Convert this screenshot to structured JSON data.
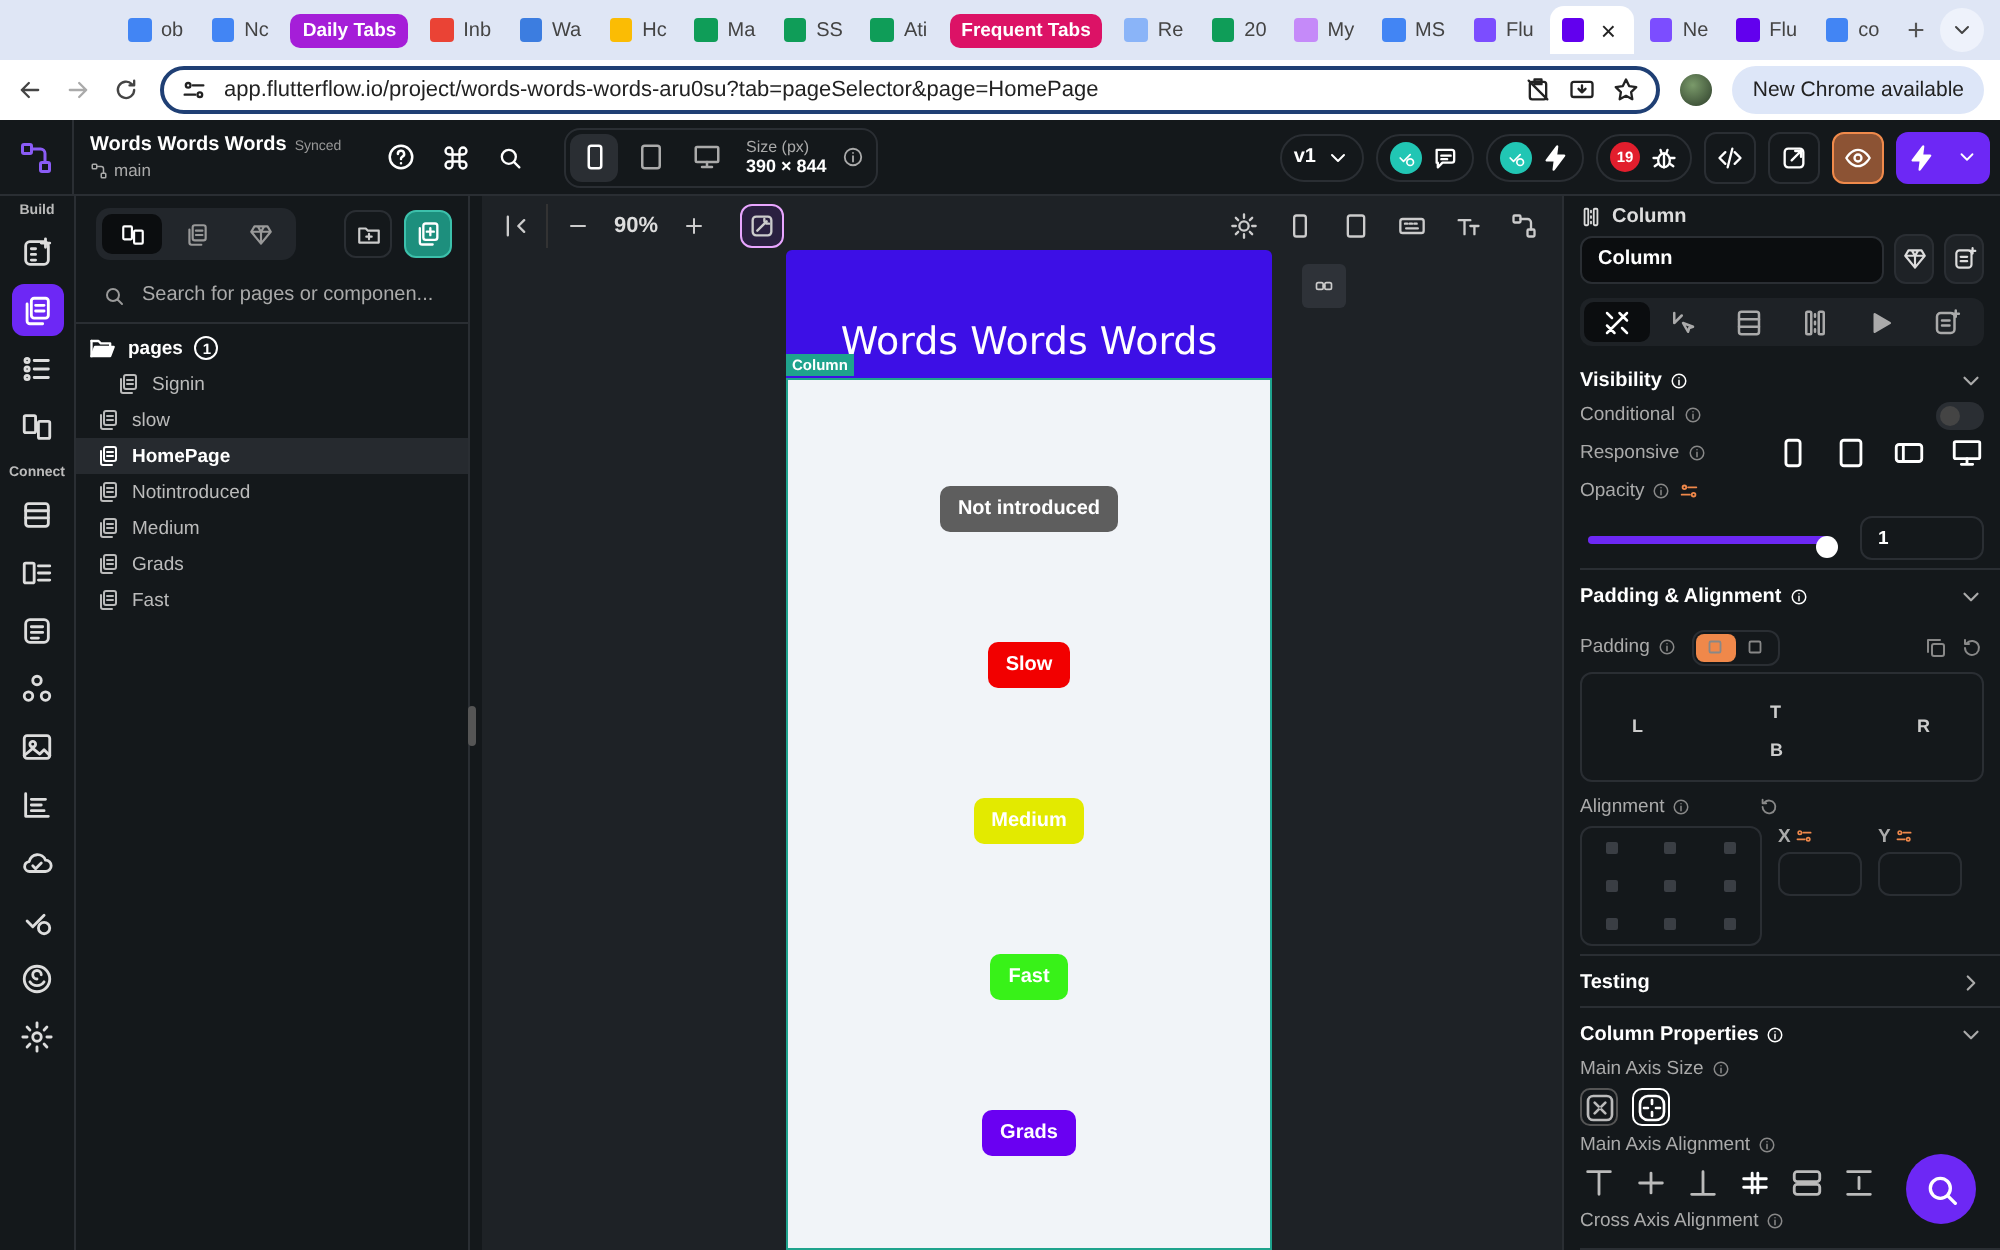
{
  "browser": {
    "tabs": [
      {
        "kind": "tab",
        "title": "ob",
        "selected": false
      },
      {
        "kind": "tab",
        "title": "Nc",
        "selected": false
      },
      {
        "kind": "group",
        "title": "Daily Tabs",
        "color": "#a51ed8"
      },
      {
        "kind": "tab",
        "title": "Inb",
        "selected": false
      },
      {
        "kind": "tab",
        "title": "Wa",
        "selected": false
      },
      {
        "kind": "tab",
        "title": "Hc",
        "selected": false
      },
      {
        "kind": "tab",
        "title": "Ma",
        "selected": false
      },
      {
        "kind": "tab",
        "title": "SS",
        "selected": false
      },
      {
        "kind": "tab",
        "title": "Ati",
        "selected": false
      },
      {
        "kind": "group",
        "title": "Frequent Tabs",
        "color": "#dc1266"
      },
      {
        "kind": "tab",
        "title": "Re",
        "selected": false
      },
      {
        "kind": "tab",
        "title": "20",
        "selected": false
      },
      {
        "kind": "tab",
        "title": "My",
        "selected": false
      },
      {
        "kind": "tab",
        "title": "MS",
        "selected": false
      },
      {
        "kind": "tab",
        "title": "Flu",
        "selected": false
      },
      {
        "kind": "tab",
        "selected": true,
        "close": "×"
      },
      {
        "kind": "tab",
        "title": "Ne",
        "selected": false
      },
      {
        "kind": "tab",
        "title": "Flu",
        "selected": false
      },
      {
        "kind": "tab",
        "title": "co",
        "selected": false
      }
    ],
    "new_tab": "+",
    "url": "app.flutterflow.io/project/words-words-words-aru0su?tab=pageSelector&page=HomePage",
    "update_button": "New Chrome available"
  },
  "toolbar": {
    "project": "Words Words Words",
    "sync_status": "Synced",
    "branch": "main",
    "devices": [
      {
        "kind": "phone",
        "selected": true
      },
      {
        "kind": "tablet",
        "selected": false
      },
      {
        "kind": "desktop",
        "selected": false
      }
    ],
    "size_label": "Size (px)",
    "size": "390 × 844",
    "version": "v1",
    "issues_count": "19",
    "preview_active": true
  },
  "rail": {
    "sections": [
      {
        "title": "Build",
        "items": [
          {
            "selected": false
          },
          {
            "selected": true
          },
          {
            "selected": false
          },
          {
            "selected": false
          }
        ]
      },
      {
        "title": "Connect",
        "items": [
          {
            "selected": false
          },
          {
            "selected": false
          },
          {
            "selected": false
          },
          {
            "selected": false
          },
          {
            "selected": false
          },
          {
            "selected": false
          },
          {
            "selected": false
          },
          {
            "selected": false
          },
          {
            "selected": false
          },
          {
            "selected": false
          }
        ]
      }
    ]
  },
  "pages_panel": {
    "tabs": [
      {
        "selected": true
      },
      {
        "selected": false
      },
      {
        "selected": false
      }
    ],
    "search_placeholder": "Search for pages or componen...",
    "tree": [
      {
        "kind": "folder",
        "name": "pages",
        "count": "1",
        "expanded": true,
        "children": [
          {
            "kind": "page",
            "name": "Signin",
            "selected": false
          }
        ]
      },
      {
        "kind": "page",
        "name": "slow",
        "selected": false
      },
      {
        "kind": "page",
        "name": "HomePage",
        "selected": true
      },
      {
        "kind": "page",
        "name": "Notintroduced",
        "selected": false
      },
      {
        "kind": "page",
        "name": "Medium",
        "selected": false
      },
      {
        "kind": "page",
        "name": "Grads",
        "selected": false
      },
      {
        "kind": "page",
        "name": "Fast",
        "selected": false
      }
    ]
  },
  "canvas": {
    "zoom": "90%",
    "screen": {
      "title": "Words Words Words",
      "selected_widget": "Column",
      "buttons": [
        {
          "label": "Not introduced",
          "color": "#5e5e5e"
        },
        {
          "label": "Slow",
          "color": "#f20000"
        },
        {
          "label": "Medium",
          "color": "#e3ea00"
        },
        {
          "label": "Fast",
          "color": "#38f218"
        },
        {
          "label": "Grads",
          "color": "#6a00f2"
        }
      ]
    }
  },
  "properties": {
    "widget_type": "Column",
    "name": "Column",
    "tabs": [
      {
        "selected": true
      },
      {
        "selected": false
      },
      {
        "selected": false
      },
      {
        "selected": false
      },
      {
        "selected": false
      },
      {
        "selected": false
      }
    ],
    "sections": [
      {
        "kind": "visibility",
        "title": "Visibility",
        "expanded": true,
        "conditional_label": "Conditional",
        "conditional_on": false,
        "responsive_label": "Responsive",
        "responsive": [
          {
            "on": true
          },
          {
            "on": true
          },
          {
            "on": true
          },
          {
            "on": true
          }
        ],
        "opacity_label": "Opacity",
        "opacity": {
          "level": 1,
          "value": "1"
        }
      },
      {
        "kind": "padding",
        "title": "Padding & Alignment",
        "expanded": true,
        "padding_label": "Padding",
        "padding_modes": [
          {
            "selected": true
          },
          {
            "selected": false
          }
        ],
        "top": "T",
        "left": "L",
        "right": "R",
        "bottom": "B",
        "alignment_label": "Alignment",
        "x_label": "X",
        "y_label": "Y"
      },
      {
        "kind": "testing",
        "title": "Testing",
        "expanded": false
      },
      {
        "kind": "column",
        "title": "Column Properties",
        "expanded": true,
        "main_axis_size_label": "Main Axis Size",
        "main_axis_size": [
          {
            "selected": false
          },
          {
            "selected": true
          }
        ],
        "main_axis_alignment_label": "Main Axis Alignment",
        "main_axis_alignment": [
          {
            "selected": false
          },
          {
            "selected": false
          },
          {
            "selected": false
          },
          {
            "selected": true
          },
          {
            "selected": false
          },
          {
            "selected": false
          }
        ],
        "cross_axis_alignment_label": "Cross Axis Alignment"
      }
    ]
  }
}
